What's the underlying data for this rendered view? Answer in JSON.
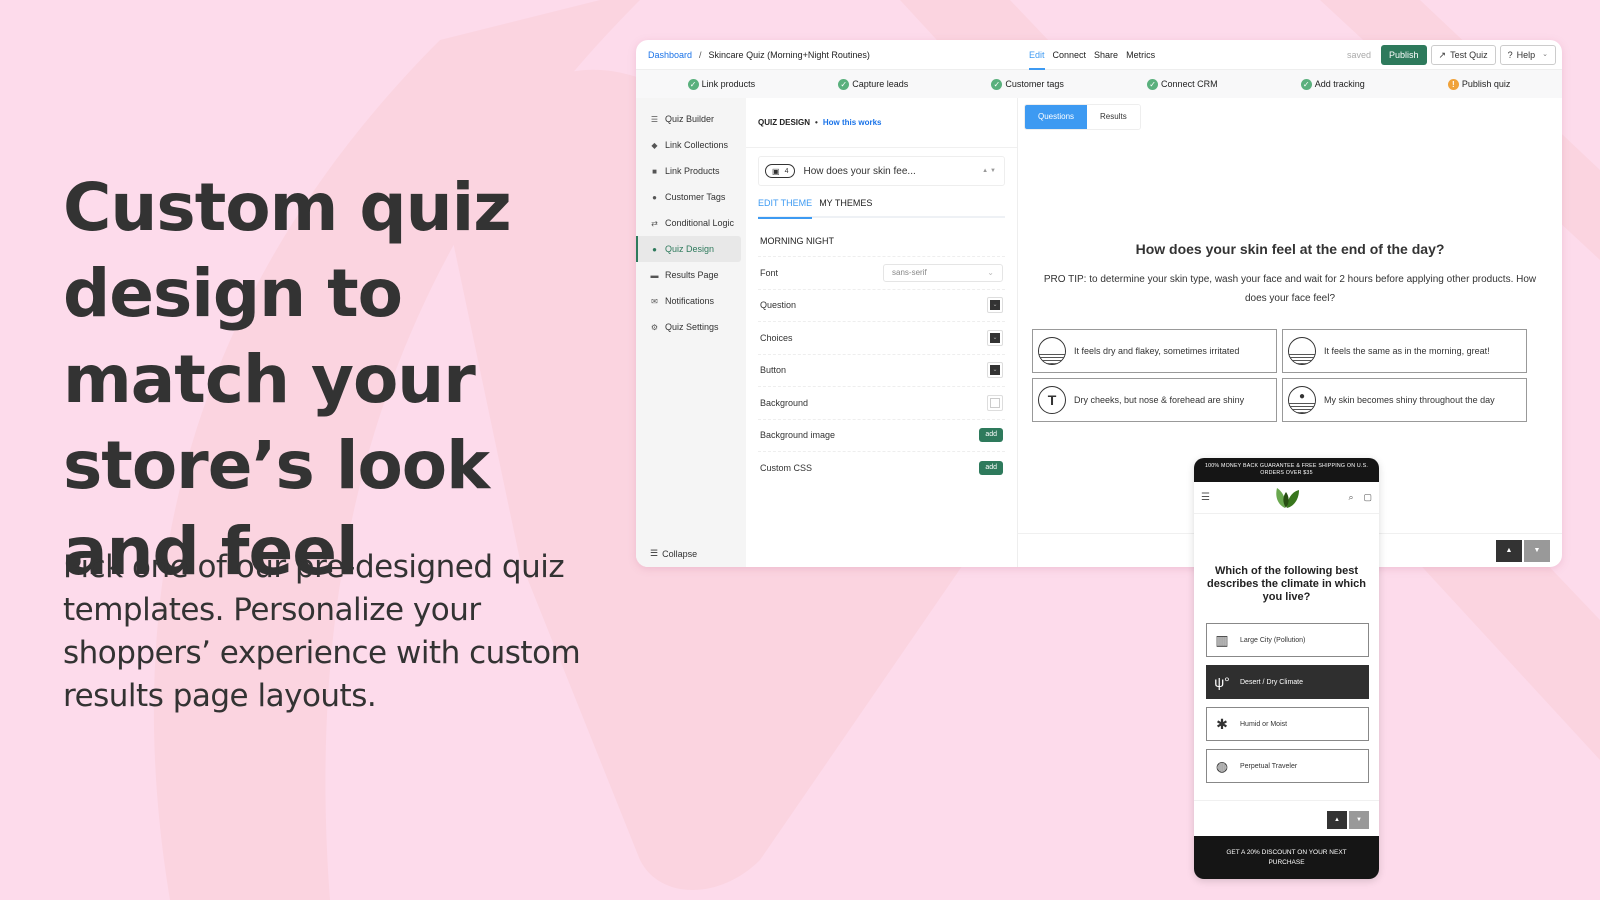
{
  "hero": {
    "title": "Custom quiz design to match your store’s look and feel",
    "subtitle": "Pick one of our pre-designed quiz templates. Personalize your shoppers’ experience with custom results page layouts."
  },
  "colors": {
    "background": "#fddbeb",
    "background_shape": "#fbd4e0",
    "accent_blue": "#3d9af2",
    "brand_green": "#2e7a5c",
    "step_ok": "#5ab07d",
    "step_warn": "#f0a23a"
  },
  "topbar": {
    "breadcrumb_root": "Dashboard",
    "breadcrumb_sep": "/",
    "quiz_title": "Skincare Quiz (Morning+Night Routines)",
    "tabs": [
      {
        "label": "Edit",
        "active": true
      },
      {
        "label": "Connect",
        "active": false
      },
      {
        "label": "Share",
        "active": false
      },
      {
        "label": "Metrics",
        "active": false
      }
    ],
    "saved_status": "saved",
    "publish_label": "Publish",
    "test_quiz_label": "Test Quiz",
    "help_label": "Help"
  },
  "steps": [
    {
      "label": "Link products",
      "status": "done"
    },
    {
      "label": "Capture leads",
      "status": "done"
    },
    {
      "label": "Customer tags",
      "status": "done"
    },
    {
      "label": "Connect CRM",
      "status": "done"
    },
    {
      "label": "Add tracking",
      "status": "done"
    },
    {
      "label": "Publish quiz",
      "status": "pending"
    }
  ],
  "sidebar": {
    "items": [
      {
        "label": "Quiz Builder",
        "icon": "list-icon",
        "active": false
      },
      {
        "label": "Link Collections",
        "icon": "tag-icon",
        "active": false
      },
      {
        "label": "Link Products",
        "icon": "gift-icon",
        "active": false
      },
      {
        "label": "Customer Tags",
        "icon": "user-icon",
        "active": false
      },
      {
        "label": "Conditional Logic",
        "icon": "branch-icon",
        "active": false
      },
      {
        "label": "Quiz Design",
        "icon": "droplet-icon",
        "active": true
      },
      {
        "label": "Results Page",
        "icon": "cart-icon",
        "active": false
      },
      {
        "label": "Notifications",
        "icon": "envelope-icon",
        "active": false
      },
      {
        "label": "Quiz Settings",
        "icon": "gear-icon",
        "active": false
      }
    ],
    "collapse_label": "Collapse"
  },
  "editor": {
    "heading": "QUIZ DESIGN",
    "dot": "•",
    "help_link": "How this works",
    "question_picker": {
      "badge_count": "4",
      "text": "How does your skin fee..."
    },
    "theme_tabs": [
      {
        "label": "EDIT THEME",
        "active": true
      },
      {
        "label": "MY THEMES",
        "active": false
      }
    ],
    "theme_name": "MORNING NIGHT",
    "font_label": "Font",
    "font_value": "sans-serif",
    "color_props": [
      {
        "label": "Question",
        "color": "#333333"
      },
      {
        "label": "Choices",
        "color": "#333333"
      },
      {
        "label": "Button",
        "color": "#333333"
      },
      {
        "label": "Background",
        "color": "#ffffff"
      }
    ],
    "add_props": [
      {
        "label": "Background image",
        "button": "add"
      },
      {
        "label": "Custom CSS",
        "button": "add"
      }
    ]
  },
  "preview": {
    "tabs": [
      {
        "label": "Questions",
        "active": true
      },
      {
        "label": "Results",
        "active": false
      }
    ],
    "question": "How does your skin feel at the end of the day?",
    "tip": "PRO TIP: to determine your skin type, wash your face and wait for 2 hours before applying other products. How does your face feel?",
    "choices": [
      {
        "label": "It feels dry and flakey, sometimes irritated",
        "icon": "dry-skin-icon"
      },
      {
        "label": "It feels the same as in the morning, great!",
        "icon": "normal-skin-icon"
      },
      {
        "label": "Dry cheeks, but nose & forehead are shiny",
        "icon": "t-zone-icon"
      },
      {
        "label": "My skin becomes shiny throughout the day",
        "icon": "oily-skin-icon"
      }
    ],
    "nav_up": "▲",
    "nav_down": "▼"
  },
  "phone": {
    "banner": "100% MONEY BACK GUARANTEE & FREE SHIPPING ON U.S. ORDERS OVER $35",
    "question": "Which of the following best describes the climate in which you live?",
    "choices": [
      {
        "label": "Large City (Pollution)",
        "icon": "city-icon",
        "selected": false
      },
      {
        "label": "Desert / Dry Climate",
        "icon": "cactus-sun-icon",
        "selected": true
      },
      {
        "label": "Humid or Moist",
        "icon": "palm-tree-icon",
        "selected": false
      },
      {
        "label": "Perpetual Traveler",
        "icon": "globe-plane-icon",
        "selected": false
      }
    ],
    "nav_up": "▲",
    "nav_down": "▼",
    "footer": "GET A 20% DISCOUNT ON YOUR NEXT PURCHASE"
  }
}
